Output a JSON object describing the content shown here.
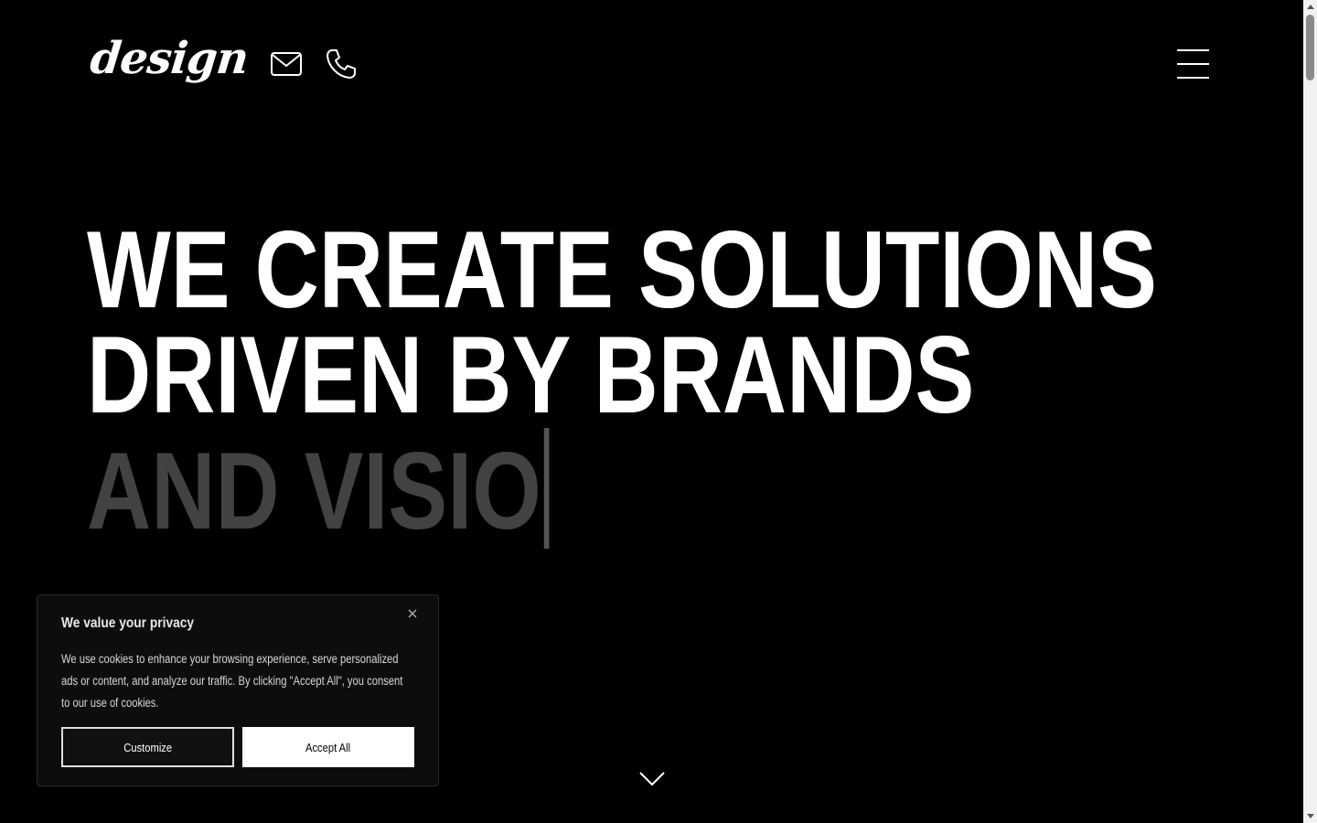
{
  "header": {
    "logo_text": "design",
    "icons": {
      "mail": "mail-icon",
      "phone": "phone-icon",
      "menu": "hamburger-menu-icon"
    }
  },
  "hero": {
    "line1": "WE CREATE SOLUTIONS",
    "line2": "DRIVEN BY BRANDS",
    "line3_typing": "AND VISIO"
  },
  "cookie_banner": {
    "title": "We value your privacy",
    "body": "We use cookies to enhance your browsing experience, serve personalized ads or content, and analyze our traffic. By clicking \"Accept All\", you consent to our use of cookies.",
    "customize_label": "Customize",
    "accept_label": "Accept All"
  },
  "colors": {
    "background": "#000000",
    "text": "#ffffff",
    "dim_text": "#424242"
  }
}
